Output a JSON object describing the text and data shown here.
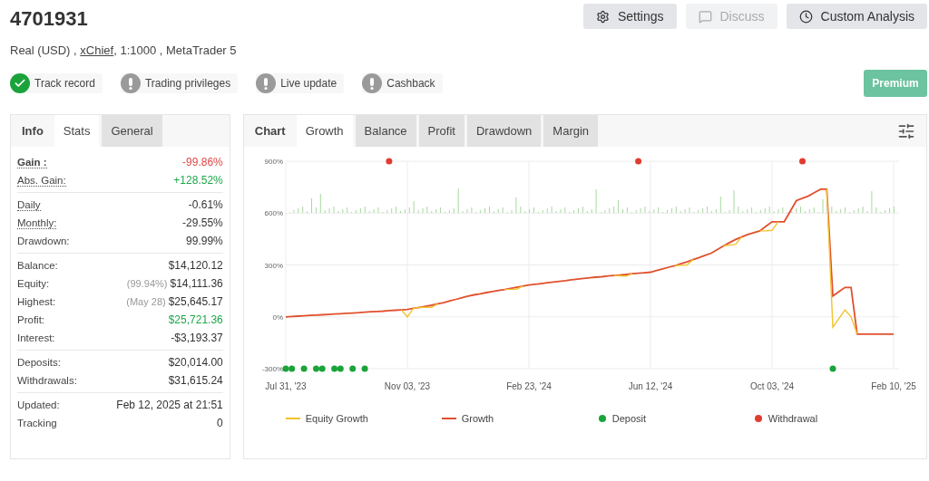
{
  "account": {
    "title": "4701931",
    "details_before": "Real (USD) ,",
    "broker_link": "xChief",
    "details_after": ", 1:1000 , MetaTrader 5"
  },
  "actions": [
    {
      "label": "Settings",
      "disabled": false
    },
    {
      "label": "Discuss",
      "disabled": true
    },
    {
      "label": "Custom Analysis",
      "disabled": false
    }
  ],
  "badges": [
    {
      "label": "Track record",
      "verified": true
    },
    {
      "label": "Trading privileges",
      "verified": false
    },
    {
      "label": "Live update",
      "verified": false
    },
    {
      "label": "Cashback",
      "verified": false
    }
  ],
  "premium_button": "Premium",
  "stats_panel": {
    "heading": "Info",
    "tabs": [
      {
        "label": "Stats",
        "selected": true
      },
      {
        "label": "General",
        "selected": false
      }
    ],
    "groups": [
      [
        {
          "label": "Gain :",
          "value": "-99.86%",
          "color": "#e04646",
          "underlined": true,
          "bold": true
        },
        {
          "label": "Abs. Gain:",
          "value": "+128.52%",
          "color": "#1ea64a",
          "underlined": true,
          "bold": false
        }
      ],
      [
        {
          "label": "Daily",
          "value": "-0.61%",
          "color": "#333333",
          "underlined": true,
          "bold": false
        },
        {
          "label": "Monthly:",
          "value": "-29.55%",
          "color": "#333333",
          "underlined": true,
          "bold": false
        },
        {
          "label": "Drawdown:",
          "value": "99.99%",
          "color": "#333333",
          "underlined": false,
          "bold": false
        }
      ],
      [
        {
          "label": "Balance:",
          "value": "$14,120.12",
          "color": "#333333",
          "underlined": false,
          "bold": false
        },
        {
          "label": "Equity:",
          "note": "(99.94%)",
          "value": "$14,111.36",
          "color": "#333333",
          "underlined": false,
          "bold": false
        },
        {
          "label": "Highest:",
          "note": "(May 28)",
          "value": "$25,645.17",
          "color": "#333333",
          "underlined": false,
          "bold": false
        },
        {
          "label": "Profit:",
          "value": "$25,721.36",
          "color": "#1ea64a",
          "underlined": false,
          "bold": false
        },
        {
          "label": "Interest:",
          "value": "-$3,193.37",
          "color": "#333333",
          "underlined": false,
          "bold": false
        }
      ],
      [
        {
          "label": "Deposits:",
          "value": "$20,014.00",
          "color": "#333333",
          "underlined": false,
          "bold": false
        },
        {
          "label": "Withdrawals:",
          "value": "$31,615.24",
          "color": "#333333",
          "underlined": false,
          "bold": false
        }
      ],
      [
        {
          "label": "Updated:",
          "value": "Feb 12, 2025 at 21:51",
          "color": "#333333",
          "underlined": false,
          "bold": false
        },
        {
          "label": "Tracking",
          "value": "0",
          "color": "#333333",
          "underlined": false,
          "bold": false
        }
      ]
    ]
  },
  "chart_panel": {
    "heading": "Chart",
    "tabs": [
      {
        "label": "Growth",
        "selected": true
      },
      {
        "label": "Balance",
        "selected": false
      },
      {
        "label": "Profit",
        "selected": false
      },
      {
        "label": "Drawdown",
        "selected": false
      },
      {
        "label": "Margin",
        "selected": false
      }
    ],
    "chart_data": {
      "type": "line",
      "grid": true,
      "ylim": [
        -300,
        900
      ],
      "categories": [
        "Jul 31, '23",
        null,
        null,
        null,
        null,
        null,
        null,
        null,
        null,
        null,
        null,
        null,
        null,
        null,
        null,
        null,
        null,
        null,
        null,
        null,
        "Nov 03, '23",
        null,
        null,
        null,
        null,
        null,
        null,
        null,
        null,
        null,
        null,
        null,
        null,
        null,
        null,
        null,
        null,
        null,
        null,
        null,
        "Feb 23, '24",
        null,
        null,
        null,
        null,
        null,
        null,
        null,
        null,
        null,
        null,
        null,
        null,
        null,
        null,
        null,
        null,
        null,
        null,
        null,
        "Jun 12, '24",
        null,
        null,
        null,
        null,
        null,
        null,
        null,
        null,
        null,
        null,
        null,
        null,
        null,
        null,
        null,
        null,
        null,
        null,
        null,
        "Oct 03, '24",
        null,
        null,
        null,
        null,
        null,
        null,
        null,
        null,
        null,
        null,
        null,
        null,
        null,
        null,
        null,
        null,
        null,
        null,
        null,
        "Feb 10, '25"
      ],
      "yticks": [
        {
          "value": 900,
          "label": "900%"
        },
        {
          "value": 600,
          "label": "600%"
        },
        {
          "value": 300,
          "label": "300%"
        },
        {
          "value": 0,
          "label": "0%"
        },
        {
          "value": -300,
          "label": "-300%"
        }
      ],
      "series": [
        {
          "name": "Equity Growth",
          "type": "line",
          "color": "#f2c12e",
          "values": [
            null,
            null,
            null,
            null,
            null,
            null,
            null,
            null,
            null,
            null,
            null,
            null,
            null,
            null,
            null,
            null,
            null,
            null,
            null,
            40,
            0,
            49,
            55,
            55,
            55,
            75,
            null,
            null,
            null,
            null,
            null,
            null,
            null,
            null,
            null,
            null,
            158,
            159,
            160,
            178,
            null,
            null,
            null,
            null,
            null,
            null,
            null,
            null,
            null,
            null,
            null,
            null,
            null,
            null,
            239,
            237,
            235,
            249,
            null,
            null,
            null,
            null,
            null,
            null,
            296,
            298,
            300,
            331,
            null,
            null,
            null,
            null,
            410,
            415,
            420,
            462,
            null,
            null,
            497,
            498,
            500,
            550,
            null,
            null,
            null,
            null,
            null,
            null,
            null,
            738,
            -60,
            -10,
            40,
            0,
            -100,
            null,
            null,
            null,
            null,
            null,
            null
          ]
        },
        {
          "name": "Growth",
          "type": "line",
          "color": "#e0502d",
          "values": [
            0,
            2,
            4,
            6,
            8,
            10,
            12,
            14,
            16,
            18,
            20,
            22,
            24,
            27,
            29,
            31,
            33,
            36,
            38,
            40,
            42,
            49,
            55,
            61,
            67,
            75,
            82,
            92,
            101,
            111,
            120,
            127,
            133,
            140,
            146,
            152,
            158,
            165,
            171,
            178,
            184,
            188,
            192,
            197,
            201,
            205,
            209,
            214,
            218,
            222,
            226,
            229,
            232,
            236,
            239,
            242,
            245,
            249,
            252,
            255,
            258,
            268,
            277,
            287,
            296,
            307,
            318,
            331,
            343,
            356,
            368,
            389,
            410,
            429,
            447,
            462,
            476,
            487,
            497,
            524,
            550,
            550,
            550,
            611,
            672,
            686,
            699,
            719,
            738,
            738,
            121,
            146,
            170,
            170,
            -100,
            -100,
            -100,
            -100,
            -100,
            -100,
            -100
          ]
        },
        {
          "name": "Deposit",
          "type": "scatter",
          "color": "#1aa33a",
          "values": [
            -300,
            -300,
            null,
            -300,
            null,
            -300,
            -300,
            null,
            -300,
            -300,
            null,
            -300,
            null,
            -300,
            null,
            null,
            null,
            null,
            null,
            null,
            null,
            null,
            null,
            null,
            null,
            null,
            null,
            null,
            null,
            null,
            null,
            null,
            null,
            null,
            null,
            null,
            null,
            null,
            null,
            null,
            null,
            null,
            null,
            null,
            null,
            null,
            null,
            null,
            null,
            null,
            null,
            null,
            null,
            null,
            null,
            null,
            null,
            null,
            null,
            null,
            null,
            null,
            null,
            null,
            null,
            null,
            null,
            null,
            null,
            null,
            null,
            null,
            null,
            null,
            null,
            null,
            null,
            null,
            null,
            null,
            null,
            null,
            null,
            null,
            null,
            null,
            null,
            null,
            null,
            null,
            -300,
            null,
            null,
            null,
            null,
            null,
            null,
            null,
            null,
            null,
            null
          ]
        },
        {
          "name": "Withdrawal",
          "type": "scatter",
          "color": "#e03c31",
          "values": [
            null,
            null,
            null,
            null,
            null,
            null,
            null,
            null,
            null,
            null,
            null,
            null,
            null,
            null,
            null,
            null,
            null,
            900,
            null,
            null,
            null,
            null,
            null,
            null,
            null,
            null,
            null,
            null,
            null,
            null,
            null,
            null,
            null,
            null,
            null,
            null,
            null,
            null,
            null,
            null,
            null,
            null,
            null,
            null,
            null,
            null,
            null,
            null,
            null,
            null,
            null,
            null,
            null,
            null,
            null,
            null,
            null,
            null,
            900,
            null,
            null,
            null,
            null,
            null,
            null,
            null,
            null,
            null,
            null,
            null,
            null,
            null,
            null,
            null,
            null,
            null,
            null,
            null,
            null,
            null,
            null,
            null,
            null,
            null,
            null,
            900,
            null,
            null,
            null,
            null,
            null,
            null,
            null,
            null,
            null,
            null,
            null,
            null,
            null,
            null,
            null
          ]
        }
      ]
    }
  }
}
